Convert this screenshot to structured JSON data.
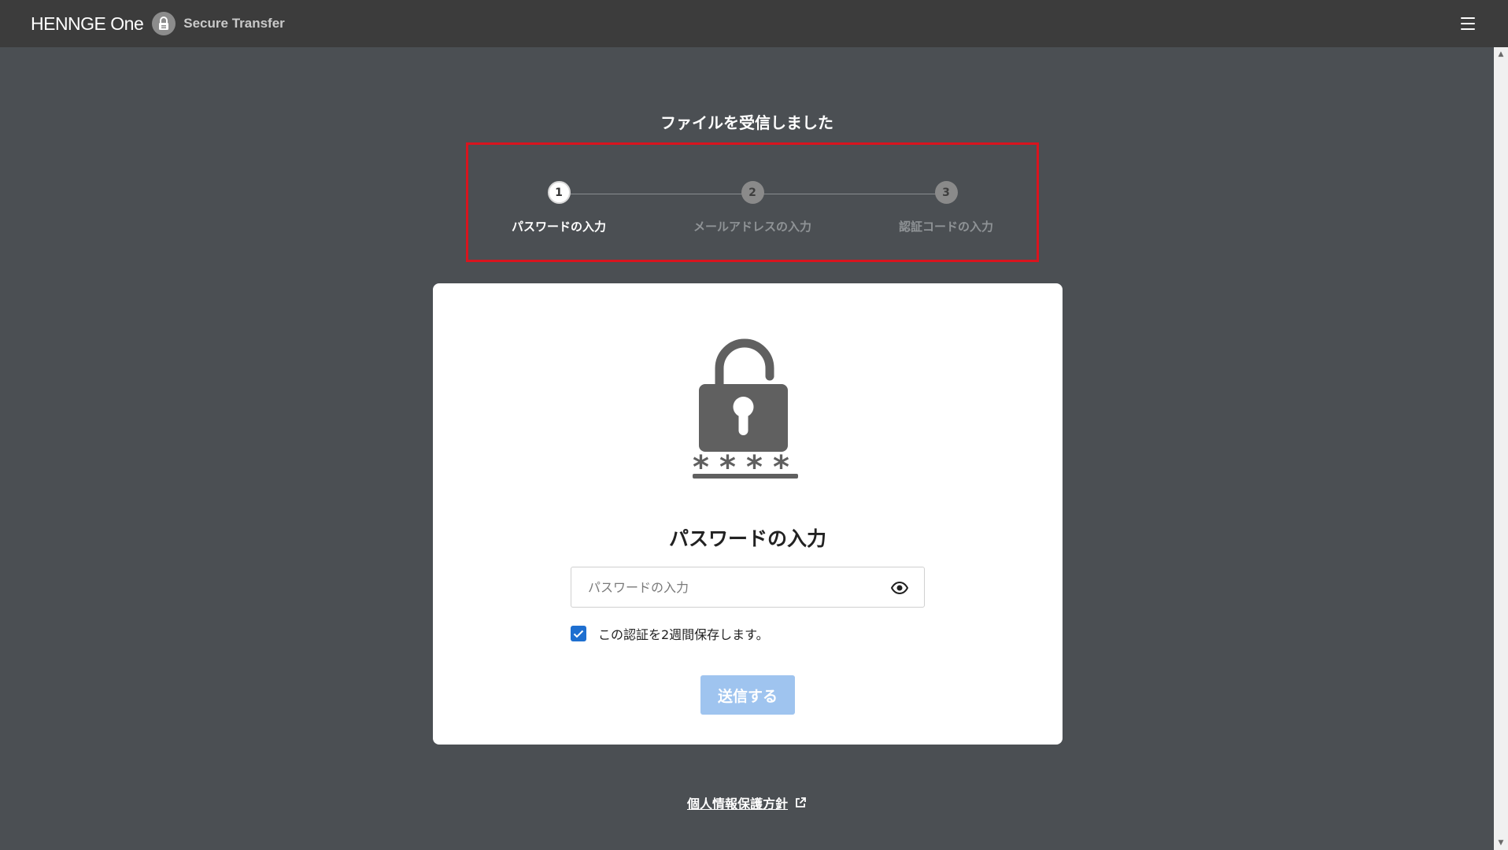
{
  "header": {
    "brand": "HENNGE One",
    "product": "Secure Transfer",
    "menu_icon": "hamburger-menu-icon"
  },
  "page": {
    "heading": "ファイルを受信しました"
  },
  "steps": [
    {
      "number": "1",
      "label": "パスワードの入力",
      "state": "active"
    },
    {
      "number": "2",
      "label": "メールアドレスの入力",
      "state": "inactive"
    },
    {
      "number": "3",
      "label": "認証コードの入力",
      "state": "inactive"
    }
  ],
  "card": {
    "illustration": "padlock-password-icon",
    "title": "パスワードの入力",
    "password": {
      "value": "",
      "placeholder": "パスワードの入力",
      "toggle_icon": "eye-icon"
    },
    "remember": {
      "checked": true,
      "label": "この認証を2週間保存します。"
    },
    "submit_label": "送信する"
  },
  "footer": {
    "privacy_link": "個人情報保護方針",
    "link_icon": "external-link-icon"
  },
  "colors": {
    "page_bg": "#4b4f53",
    "topbar_bg": "#3c3c3c",
    "highlight_border": "#d9141e",
    "submit_disabled": "#9fc4ef",
    "checkbox": "#1e6fd0"
  }
}
